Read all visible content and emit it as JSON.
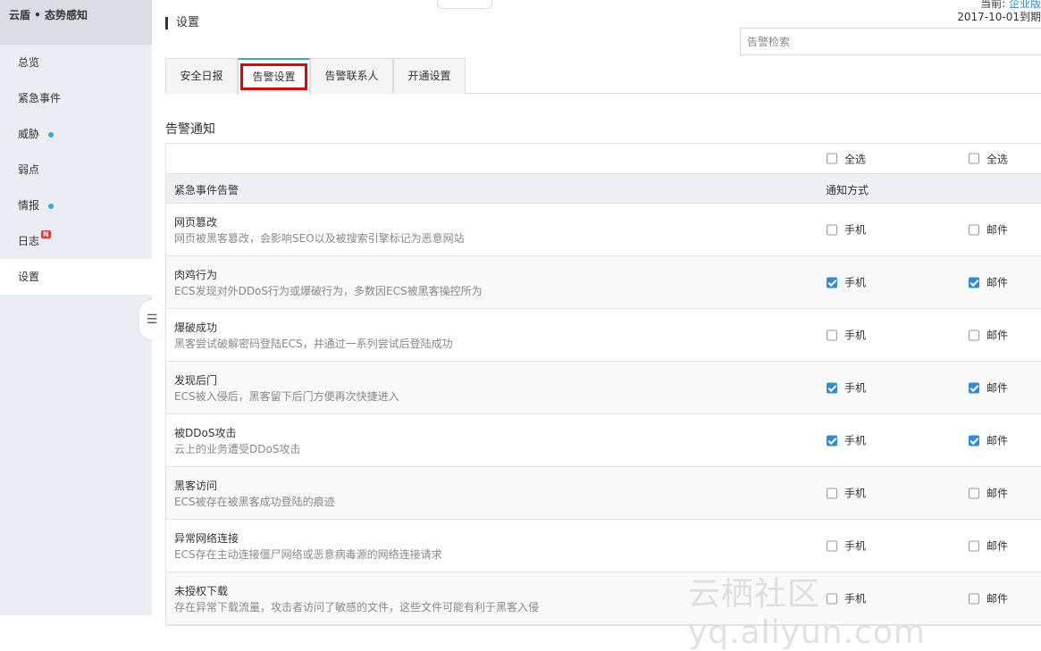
{
  "sidebar": {
    "brand": "云盾 • 态势感知",
    "items": [
      {
        "label": "总览"
      },
      {
        "label": "紧急事件"
      },
      {
        "label": "威胁"
      },
      {
        "label": "弱点"
      },
      {
        "label": "情报"
      },
      {
        "label": "日志",
        "badge": "N"
      },
      {
        "label": "设置"
      }
    ]
  },
  "header": {
    "title": "设置",
    "current_label": "当前:",
    "current_link": "企业版",
    "date_range": "2017-10-01到期",
    "search_placeholder": "告警检索"
  },
  "tabs": [
    "安全日报",
    "告警设置",
    "告警联系人",
    "开通设置"
  ],
  "section_title": "告警通知",
  "table": {
    "select_all_1": "全选",
    "select_all_2": "全选",
    "head_label": "紧急事件告警",
    "head_method": "通知方式",
    "phone_label": "手机",
    "mail_label": "邮件",
    "rows": [
      {
        "title": "网页篡改",
        "desc": "网页被黑客篡改，会影响SEO以及被搜索引擎标记为恶意网站",
        "phone": false,
        "mail": false
      },
      {
        "title": "肉鸡行为",
        "desc": "ECS发现对外DDoS行为或爆破行为，多数因ECS被黑客操控所为",
        "phone": true,
        "mail": true
      },
      {
        "title": "爆破成功",
        "desc": "黑客尝试破解密码登陆ECS，并通过一系列尝试后登陆成功",
        "phone": false,
        "mail": false
      },
      {
        "title": "发现后门",
        "desc": "ECS被入侵后，黑客留下后门方便再次快捷进入",
        "phone": true,
        "mail": true
      },
      {
        "title": "被DDoS攻击",
        "desc": "云上的业务遭受DDoS攻击",
        "phone": true,
        "mail": true
      },
      {
        "title": "黑客访问",
        "desc": "ECS被存在被黑客成功登陆的痕迹",
        "phone": false,
        "mail": false
      },
      {
        "title": "异常网络连接",
        "desc": "ECS存在主动连接僵尸网络或恶意病毒源的网络连接请求",
        "phone": false,
        "mail": false
      },
      {
        "title": "未授权下载",
        "desc": "存在异常下载流量，攻击者访问了敏感的文件，这些文件可能有利于黑客入侵",
        "phone": false,
        "mail": false
      }
    ]
  },
  "watermark": "云栖社区 yq.aliyun.com"
}
